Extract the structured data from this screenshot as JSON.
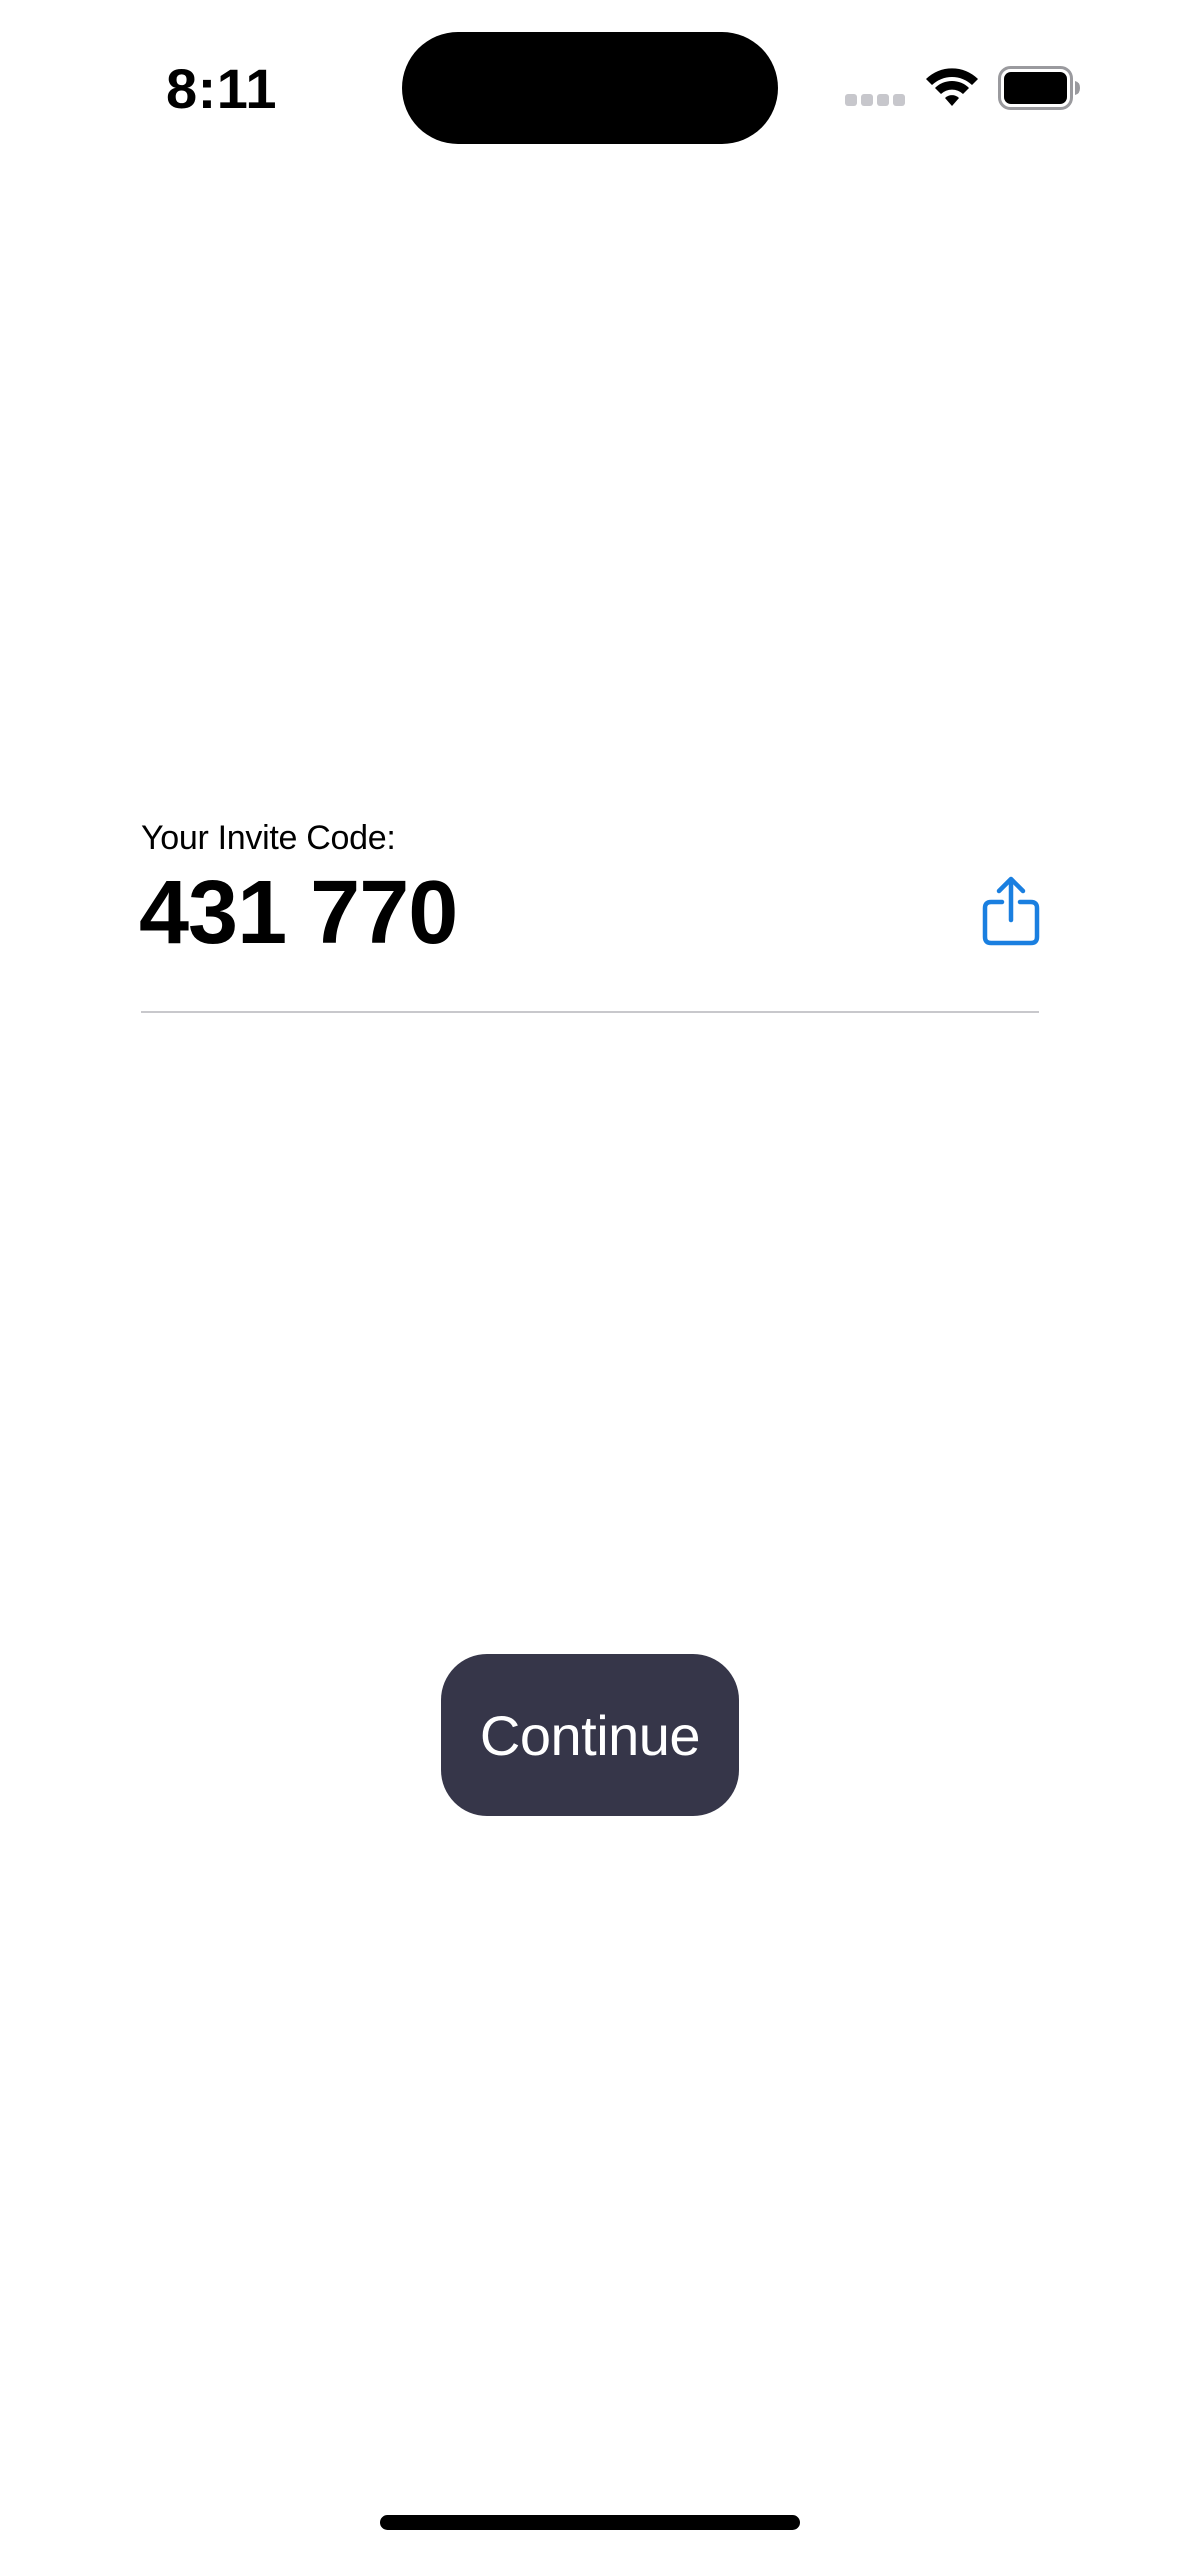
{
  "status_bar": {
    "time": "8:11",
    "icons": [
      "signal-icon",
      "wifi-icon",
      "battery-icon"
    ]
  },
  "invite": {
    "label": "Your Invite Code:",
    "code": "431 770",
    "share_icon": "share-icon"
  },
  "actions": {
    "continue_label": "Continue"
  },
  "colors": {
    "accent": "#1a7fe0",
    "button_background": "#363649",
    "button_text": "#ffffff",
    "divider": "#c8c8cc"
  }
}
